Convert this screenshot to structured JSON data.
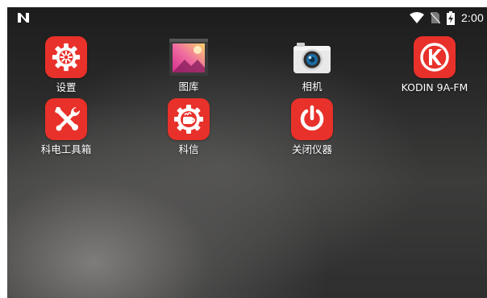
{
  "status_bar": {
    "clock": "2:00",
    "icons": [
      "notification-n-icon",
      "wifi-icon",
      "no-sim-icon",
      "battery-charging-icon"
    ]
  },
  "apps": [
    {
      "name": "settings",
      "label": "设置",
      "icon": "gear-icon",
      "color": "#e8312a"
    },
    {
      "name": "gallery",
      "label": "图库",
      "icon": "gallery-icon",
      "color": "#c43a8a"
    },
    {
      "name": "camera",
      "label": "相机",
      "icon": "camera-icon",
      "color": "#e6e6e6"
    },
    {
      "name": "kodin",
      "label": "KODIN 9A-FM",
      "icon": "kodin-logo-icon",
      "color": "#e8312a"
    },
    {
      "name": "toolbox",
      "label": "科电工具箱",
      "icon": "tools-icon",
      "color": "#e8312a"
    },
    {
      "name": "kexin",
      "label": "科信",
      "icon": "kexin-icon",
      "color": "#e8312a"
    },
    {
      "name": "shutdown",
      "label": "关闭仪器",
      "icon": "power-icon",
      "color": "#e8312a"
    }
  ]
}
